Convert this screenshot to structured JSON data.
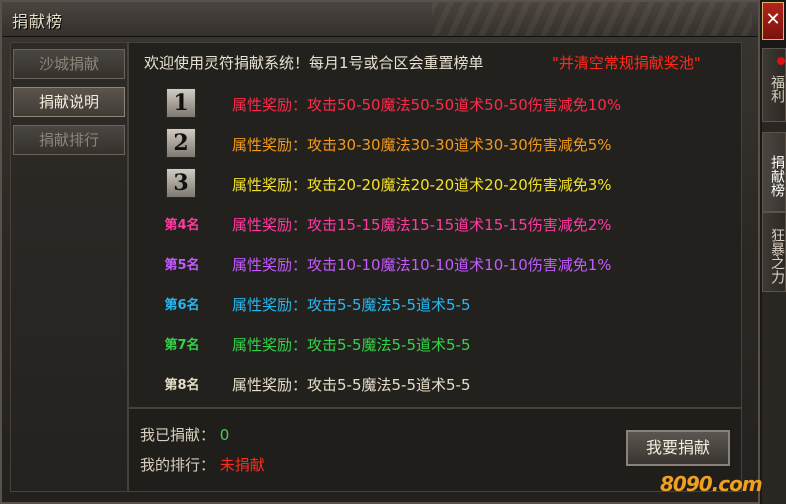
{
  "window": {
    "title": "捐献榜"
  },
  "close": {
    "glyph": "✕"
  },
  "side_tabs": [
    {
      "label": "福利"
    },
    {
      "label": "捐献榜"
    },
    {
      "label": "狂暴之力"
    }
  ],
  "nav": [
    {
      "label": "沙城捐献"
    },
    {
      "label": "捐献说明"
    },
    {
      "label": "捐献排行"
    }
  ],
  "intro": {
    "welcome": "欢迎使用灵符捐献系统！每月1号或合区会重置榜单",
    "clear_note": "\"并清空常规捐献奖池\""
  },
  "ranks": [
    {
      "label": "1",
      "text": "属性奖励：攻击50-50魔法50-50道术50-50伤害减免10%",
      "color": "#ff2a4a",
      "label_color": "#111111"
    },
    {
      "label": "2",
      "text": "属性奖励：攻击30-30魔法30-30道术30-30伤害减免5%",
      "color": "#f29a1a",
      "label_color": "#111111"
    },
    {
      "label": "3",
      "text": "属性奖励：攻击20-20魔法20-20道术20-20伤害减免3%",
      "color": "#f2e02a",
      "label_color": "#111111"
    },
    {
      "label": "第4名",
      "text": "属性奖励：攻击15-15魔法15-15道术15-15伤害减免2%",
      "color": "#ff3aa0",
      "label_color": "#ff3aa0"
    },
    {
      "label": "第5名",
      "text": "属性奖励：攻击10-10魔法10-10道术10-10伤害减免1%",
      "color": "#c45aff",
      "label_color": "#c45aff"
    },
    {
      "label": "第6名",
      "text": "属性奖励：攻击5-5魔法5-5道术5-5",
      "color": "#28b8f0",
      "label_color": "#28b8f0"
    },
    {
      "label": "第7名",
      "text": "属性奖励：攻击5-5魔法5-5道术5-5",
      "color": "#34d24a",
      "label_color": "#34d24a"
    },
    {
      "label": "第8名",
      "text": "属性奖励：攻击5-5魔法5-5道术5-5",
      "color": "#e6ddc8",
      "label_color": "#e6ddc8"
    }
  ],
  "footer": {
    "donated_label": "我已捐献：",
    "donated_value": "0",
    "rank_label": "我的排行：",
    "rank_value": "未捐献"
  },
  "donate_button": "我要捐献",
  "watermark": "8090.com"
}
